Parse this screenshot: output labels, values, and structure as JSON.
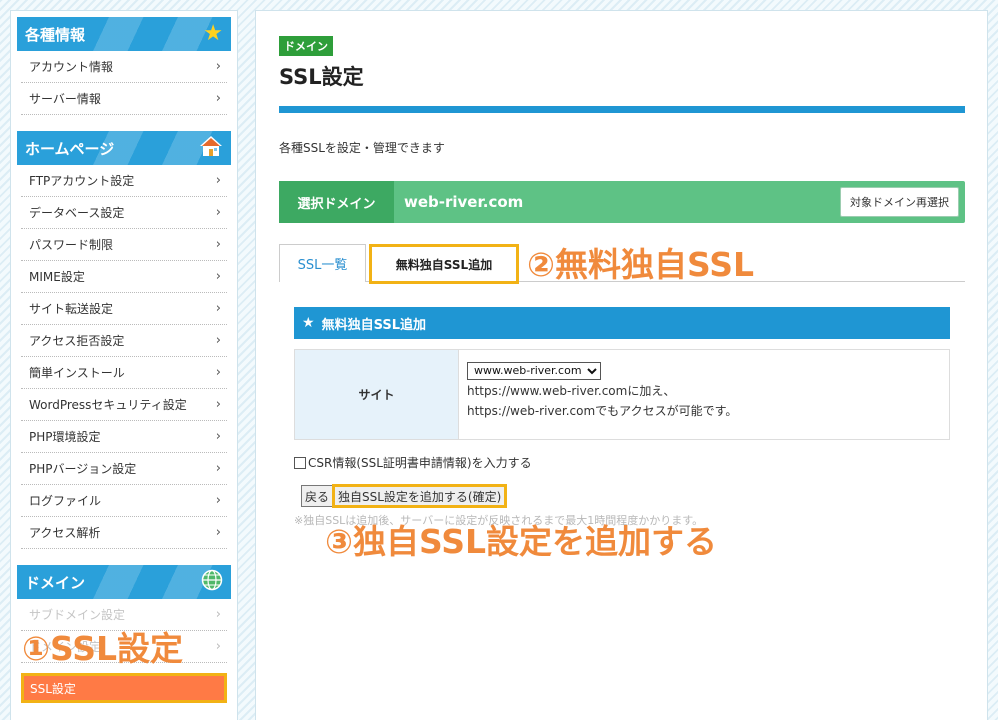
{
  "sidebar": {
    "sections": [
      {
        "title": "各種情報",
        "icon": "star-icon",
        "items": [
          "アカウント情報",
          "サーバー情報"
        ]
      },
      {
        "title": "ホームページ",
        "icon": "house-icon",
        "items": [
          "FTPアカウント設定",
          "データベース設定",
          "パスワード制限",
          "MIME設定",
          "サイト転送設定",
          "アクセス拒否設定",
          "簡単インストール",
          "WordPressセキュリティ設定",
          "PHP環境設定",
          "PHPバージョン設定",
          "ログファイル",
          "アクセス解析"
        ]
      },
      {
        "title": "ドメイン",
        "icon": "globe-icon",
        "items": [
          "サブドメイン設定",
          "ドメイン設定"
        ]
      }
    ],
    "active_item": "SSL設定"
  },
  "annotations": {
    "step1": "①SSL設定",
    "step2": "②無料独自SSL",
    "step3": "③独自SSL設定を追加する"
  },
  "main": {
    "category_badge": "ドメイン",
    "title": "SSL設定",
    "description": "各種SSLを設定・管理できます",
    "domain_bar": {
      "label": "選択ドメイン",
      "value": "web-river.com",
      "reselect_button": "対象ドメイン再選択"
    },
    "tabs": [
      {
        "label": "SSL一覧",
        "active": false
      },
      {
        "label": "無料独自SSL追加",
        "active": true
      }
    ],
    "panel_title": "無料独自SSL追加",
    "site": {
      "label": "サイト",
      "selected": "www.web-river.com",
      "line1": "https://www.web-river.comに加え、",
      "line2": "https://web-river.comでもアクセスが可能です。"
    },
    "csr_label": "CSR情報(SSL証明書申請情報)を入力する",
    "back_button": "戻る",
    "confirm_button": "独自SSL設定を追加する(確定)",
    "note": "※独自SSLは追加後、サーバーに設定が反映されるまで最大1時間程度かかります。"
  },
  "colors": {
    "accent": "#1f96d3",
    "green": "#5ec285",
    "highlight": "#f2b215",
    "annotation": "#f08a3c",
    "active_item": "#ff7a45"
  }
}
